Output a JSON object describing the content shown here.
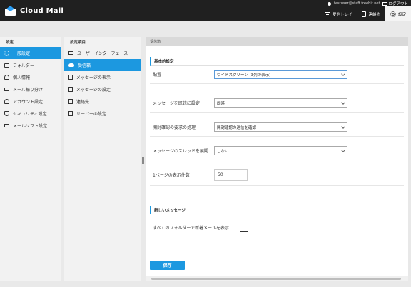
{
  "app": {
    "title": "Cloud Mail"
  },
  "user": {
    "email": "testuser@staff.freebit.net",
    "logout_label": "ログアウト"
  },
  "topnav": [
    {
      "label": "受信トレイ",
      "icon": "inbox-icon"
    },
    {
      "label": "連絡先",
      "icon": "address-book-icon"
    },
    {
      "label": "設定",
      "icon": "gear-icon"
    }
  ],
  "sidebar": {
    "title": "設定",
    "items": [
      {
        "label": "一般設定",
        "icon": "gear-icon",
        "active": true
      },
      {
        "label": "フォルダー",
        "icon": "folder-icon"
      },
      {
        "label": "個人情報",
        "icon": "person-icon"
      },
      {
        "label": "メール振り分け",
        "icon": "mail-filter-icon"
      },
      {
        "label": "アカウント設定",
        "icon": "account-icon"
      },
      {
        "label": "セキュリティ設定",
        "icon": "shield-icon"
      },
      {
        "label": "メールソフト設定",
        "icon": "monitor-icon"
      }
    ]
  },
  "subnav": {
    "title": "設定項目",
    "items": [
      {
        "label": "ユーザーインターフェース",
        "icon": "monitor-icon"
      },
      {
        "label": "受信箱",
        "icon": "cloud-icon",
        "active": true
      },
      {
        "label": "メッセージの表示",
        "icon": "document-icon"
      },
      {
        "label": "メッセージの設定",
        "icon": "document-icon"
      },
      {
        "label": "連絡先",
        "icon": "contacts-icon"
      },
      {
        "label": "サーバーの設定",
        "icon": "server-icon"
      }
    ]
  },
  "content": {
    "header": "受信箱",
    "basic": {
      "title": "基本的設定",
      "layout_label": "配置",
      "layout_value": "ワイドスクリーン (3列の表示)",
      "mark_read_label": "メッセージを既読に設定",
      "mark_read_value": "即時",
      "receipt_label": "開封確認の要求の処理",
      "receipt_value": "開封確認の送信を確認",
      "thread_label": "メッセージのスレッドを展開",
      "thread_value": "しない",
      "per_page_label": "1ページの表示件数",
      "per_page_value": "50"
    },
    "newmsg": {
      "title": "新しいメッセージ",
      "check_all_label": "すべてのフォルダーで新着メールを表示",
      "check_all_checked": false
    },
    "save_label": "保存"
  },
  "colors": {
    "accent": "#1c98e0",
    "topbar": "#202020"
  }
}
